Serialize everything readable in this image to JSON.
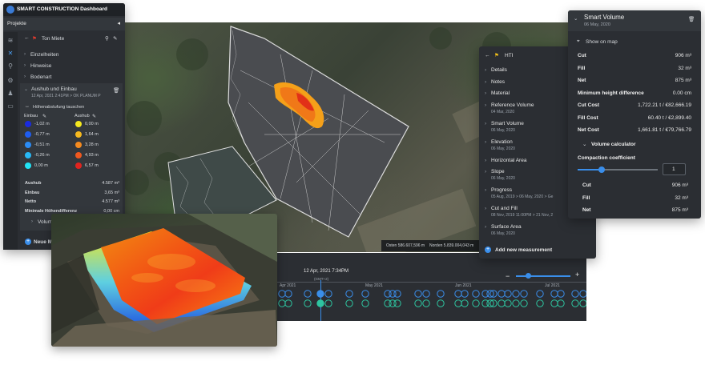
{
  "app": {
    "title": "SMART CONSTRUCTION Dashboard"
  },
  "sidebar": {
    "projects_label": "Projekte",
    "item_title": "Ton Miete",
    "sections": [
      "Einzelheiten",
      "Hinweise",
      "Bodenart"
    ],
    "measurement": {
      "title": "Aushub und Einbau",
      "subtitle": "12 Apr, 2021 2:41PM > OK PLANUM P"
    },
    "swap_label": "Höhenabstufung tauschen",
    "einbau_label": "Einbau",
    "aushub_label": "Aushub",
    "einbau_values": [
      "-1,02 m",
      "-0,77 m",
      "-0,51 m",
      "-0,26 m",
      "0,00 m"
    ],
    "einbau_colors": [
      "#1a2be0",
      "#1f5df0",
      "#2b8cf5",
      "#28b8f5",
      "#22e3f5"
    ],
    "aushub_values": [
      "0,00 m",
      "1,64 m",
      "3,28 m",
      "4,93 m",
      "6,57 m"
    ],
    "aushub_colors": [
      "#f5e81f",
      "#f5b81f",
      "#f58a1f",
      "#f0581f",
      "#e0241f"
    ],
    "stats": [
      {
        "label": "Aushub",
        "value": "4.587 m³"
      },
      {
        "label": "Einbau",
        "value": "3,65 m³"
      },
      {
        "label": "Netto",
        "value": "4.577 m³"
      },
      {
        "label": "Minimale Höhendifferenz",
        "value": "0,00 cm"
      }
    ],
    "volumen_label": "Volum",
    "new_label": "Neue M"
  },
  "map": {
    "coords_east": "Osten 586.607,596 m",
    "coords_north": "Norden 5.839.004,043 m"
  },
  "timeline": {
    "current": "12 Apr, 2021 7:34PM",
    "timezone": "(GMT+2)",
    "months": [
      "Apr 2021",
      "May 2021",
      "Jun 2021",
      "Jul 2021"
    ]
  },
  "hti": {
    "title": "HTI",
    "items": [
      {
        "label": "Details",
        "sub": ""
      },
      {
        "label": "Notes",
        "sub": ""
      },
      {
        "label": "Material",
        "sub": ""
      },
      {
        "label": "Reference Volume",
        "sub": "04 Mar, 2020"
      },
      {
        "label": "Smart Volume",
        "sub": "06 May, 2020"
      },
      {
        "label": "Elevation",
        "sub": "06 May, 2020"
      },
      {
        "label": "Horizontal Area",
        "sub": ""
      },
      {
        "label": "Slope",
        "sub": "06 May, 2020"
      },
      {
        "label": "Progress",
        "sub": "05 Aug, 2019 > 06 May, 2020 > Ge"
      },
      {
        "label": "Cut and Fill",
        "sub": "08 Nov, 2019 11:00PM > 21 Nov, 2"
      },
      {
        "label": "Surface Area",
        "sub": "06 May, 2020"
      }
    ],
    "add_label": "Add new measurement"
  },
  "smart_volume": {
    "title": "Smart Volume",
    "date": "06 May, 2020",
    "show_on_map": "Show on map",
    "stats": [
      {
        "label": "Cut",
        "value": "906 m³"
      },
      {
        "label": "Fill",
        "value": "32 m³"
      },
      {
        "label": "Net",
        "value": "875 m³"
      },
      {
        "label": "Minimum height difference",
        "value": "0.00 cm"
      },
      {
        "label": "Cut Cost",
        "value": "1,722.21 t / €82,666.19"
      },
      {
        "label": "Fill Cost",
        "value": "60.40 t / €2,899.40"
      },
      {
        "label": "Net Cost",
        "value": "1,661.81 t / €79,766.79"
      }
    ],
    "calculator_title": "Volume calculator",
    "compaction_label": "Compaction coefficient",
    "compaction_value": "1",
    "compaction_level": 0.3,
    "calc_stats": [
      {
        "label": "Cut",
        "value": "906 m³"
      },
      {
        "label": "Fill",
        "value": "32 m³"
      },
      {
        "label": "Net",
        "value": "875 m³"
      }
    ]
  }
}
